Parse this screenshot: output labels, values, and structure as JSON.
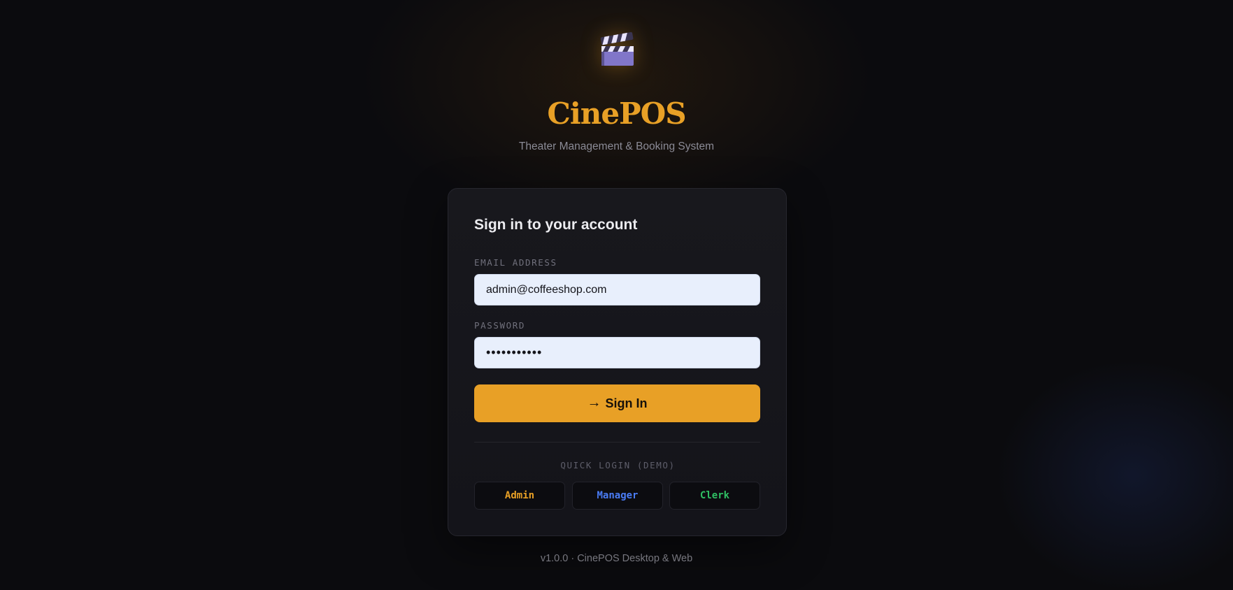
{
  "brand": {
    "icon": "clapperboard-icon",
    "title": "CinePOS",
    "subtitle": "Theater Management & Booking System",
    "accent_color": "#e8a026"
  },
  "login": {
    "heading": "Sign in to your account",
    "email_label": "EMAIL ADDRESS",
    "email_value": "admin@coffeeshop.com",
    "password_label": "PASSWORD",
    "password_value": "•••••••••••",
    "submit_icon": "arrow-right-icon",
    "submit_arrow": "→",
    "submit_label": "Sign In"
  },
  "quick_login": {
    "label": "QUICK LOGIN (DEMO)",
    "buttons": [
      {
        "label": "Admin",
        "color": "#e8a026"
      },
      {
        "label": "Manager",
        "color": "#4a7cf5"
      },
      {
        "label": "Clerk",
        "color": "#2fbf63"
      }
    ]
  },
  "footer": {
    "text": "v1.0.0 · CinePOS Desktop & Web"
  }
}
